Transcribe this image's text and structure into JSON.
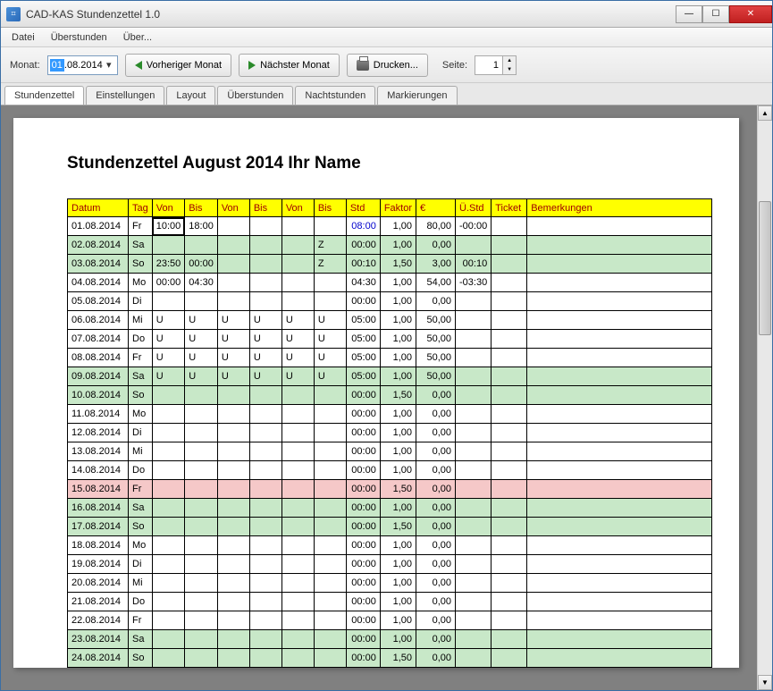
{
  "window": {
    "title": "CAD-KAS Stundenzettel 1.0"
  },
  "menu": {
    "file": "Datei",
    "overtime": "Überstunden",
    "about": "Über..."
  },
  "toolbar": {
    "month_label": "Monat:",
    "date_value": "01.08.2014",
    "date_sel": "01",
    "date_rest": ".08.2014",
    "prev": "Vorheriger Monat",
    "next": "Nächster Monat",
    "print": "Drucken...",
    "page_label": "Seite:",
    "page_value": "1"
  },
  "tabs": [
    "Stundenzettel",
    "Einstellungen",
    "Layout",
    "Überstunden",
    "Nachtstunden",
    "Markierungen"
  ],
  "doc": {
    "title": "Stundenzettel August 2014 Ihr Name"
  },
  "columns": [
    "Datum",
    "Tag",
    "Von",
    "Bis",
    "Von",
    "Bis",
    "Von",
    "Bis",
    "Std",
    "Faktor",
    "€",
    "Ü.Std",
    "Ticket",
    "Bemerkungen"
  ],
  "rows": [
    {
      "date": "01.08.2014",
      "day": "Fr",
      "v1": "10:00",
      "b1": "18:00",
      "v2": "",
      "b2": "",
      "v3": "",
      "b3": "",
      "std": "08:00",
      "faktor": "1,00",
      "eur": "80,00",
      "ustd": "-00:00",
      "cls": "",
      "stdBlue": true,
      "sel": true
    },
    {
      "date": "02.08.2014",
      "day": "Sa",
      "v1": "",
      "b1": "",
      "v2": "",
      "b2": "",
      "v3": "",
      "b3": "Z",
      "std": "00:00",
      "faktor": "1,00",
      "eur": "0,00",
      "ustd": "",
      "cls": "row-green"
    },
    {
      "date": "03.08.2014",
      "day": "So",
      "v1": "23:50",
      "b1": "00:00",
      "v2": "",
      "b2": "",
      "v3": "",
      "b3": "Z",
      "std": "00:10",
      "faktor": "1,50",
      "eur": "3,00",
      "ustd": "00:10",
      "cls": "row-green"
    },
    {
      "date": "04.08.2014",
      "day": "Mo",
      "v1": "00:00",
      "b1": "04:30",
      "v2": "",
      "b2": "",
      "v3": "",
      "b3": "",
      "std": "04:30",
      "faktor": "1,00",
      "eur": "54,00",
      "ustd": "-03:30",
      "cls": ""
    },
    {
      "date": "05.08.2014",
      "day": "Di",
      "v1": "",
      "b1": "",
      "v2": "",
      "b2": "",
      "v3": "",
      "b3": "",
      "std": "00:00",
      "faktor": "1,00",
      "eur": "0,00",
      "ustd": "",
      "cls": ""
    },
    {
      "date": "06.08.2014",
      "day": "Mi",
      "v1": "U",
      "b1": "U",
      "v2": "U",
      "b2": "U",
      "v3": "U",
      "b3": "U",
      "std": "05:00",
      "faktor": "1,00",
      "eur": "50,00",
      "ustd": "",
      "cls": ""
    },
    {
      "date": "07.08.2014",
      "day": "Do",
      "v1": "U",
      "b1": "U",
      "v2": "U",
      "b2": "U",
      "v3": "U",
      "b3": "U",
      "std": "05:00",
      "faktor": "1,00",
      "eur": "50,00",
      "ustd": "",
      "cls": ""
    },
    {
      "date": "08.08.2014",
      "day": "Fr",
      "v1": "U",
      "b1": "U",
      "v2": "U",
      "b2": "U",
      "v3": "U",
      "b3": "U",
      "std": "05:00",
      "faktor": "1,00",
      "eur": "50,00",
      "ustd": "",
      "cls": ""
    },
    {
      "date": "09.08.2014",
      "day": "Sa",
      "v1": "U",
      "b1": "U",
      "v2": "U",
      "b2": "U",
      "v3": "U",
      "b3": "U",
      "std": "05:00",
      "faktor": "1,00",
      "eur": "50,00",
      "ustd": "",
      "cls": "row-green"
    },
    {
      "date": "10.08.2014",
      "day": "So",
      "v1": "",
      "b1": "",
      "v2": "",
      "b2": "",
      "v3": "",
      "b3": "",
      "std": "00:00",
      "faktor": "1,50",
      "eur": "0,00",
      "ustd": "",
      "cls": "row-green"
    },
    {
      "date": "11.08.2014",
      "day": "Mo",
      "v1": "",
      "b1": "",
      "v2": "",
      "b2": "",
      "v3": "",
      "b3": "",
      "std": "00:00",
      "faktor": "1,00",
      "eur": "0,00",
      "ustd": "",
      "cls": ""
    },
    {
      "date": "12.08.2014",
      "day": "Di",
      "v1": "",
      "b1": "",
      "v2": "",
      "b2": "",
      "v3": "",
      "b3": "",
      "std": "00:00",
      "faktor": "1,00",
      "eur": "0,00",
      "ustd": "",
      "cls": ""
    },
    {
      "date": "13.08.2014",
      "day": "Mi",
      "v1": "",
      "b1": "",
      "v2": "",
      "b2": "",
      "v3": "",
      "b3": "",
      "std": "00:00",
      "faktor": "1,00",
      "eur": "0,00",
      "ustd": "",
      "cls": ""
    },
    {
      "date": "14.08.2014",
      "day": "Do",
      "v1": "",
      "b1": "",
      "v2": "",
      "b2": "",
      "v3": "",
      "b3": "",
      "std": "00:00",
      "faktor": "1,00",
      "eur": "0,00",
      "ustd": "",
      "cls": ""
    },
    {
      "date": "15.08.2014",
      "day": "Fr",
      "v1": "",
      "b1": "",
      "v2": "",
      "b2": "",
      "v3": "",
      "b3": "",
      "std": "00:00",
      "faktor": "1,50",
      "eur": "0,00",
      "ustd": "",
      "cls": "row-pink"
    },
    {
      "date": "16.08.2014",
      "day": "Sa",
      "v1": "",
      "b1": "",
      "v2": "",
      "b2": "",
      "v3": "",
      "b3": "",
      "std": "00:00",
      "faktor": "1,00",
      "eur": "0,00",
      "ustd": "",
      "cls": "row-green"
    },
    {
      "date": "17.08.2014",
      "day": "So",
      "v1": "",
      "b1": "",
      "v2": "",
      "b2": "",
      "v3": "",
      "b3": "",
      "std": "00:00",
      "faktor": "1,50",
      "eur": "0,00",
      "ustd": "",
      "cls": "row-green"
    },
    {
      "date": "18.08.2014",
      "day": "Mo",
      "v1": "",
      "b1": "",
      "v2": "",
      "b2": "",
      "v3": "",
      "b3": "",
      "std": "00:00",
      "faktor": "1,00",
      "eur": "0,00",
      "ustd": "",
      "cls": ""
    },
    {
      "date": "19.08.2014",
      "day": "Di",
      "v1": "",
      "b1": "",
      "v2": "",
      "b2": "",
      "v3": "",
      "b3": "",
      "std": "00:00",
      "faktor": "1,00",
      "eur": "0,00",
      "ustd": "",
      "cls": ""
    },
    {
      "date": "20.08.2014",
      "day": "Mi",
      "v1": "",
      "b1": "",
      "v2": "",
      "b2": "",
      "v3": "",
      "b3": "",
      "std": "00:00",
      "faktor": "1,00",
      "eur": "0,00",
      "ustd": "",
      "cls": ""
    },
    {
      "date": "21.08.2014",
      "day": "Do",
      "v1": "",
      "b1": "",
      "v2": "",
      "b2": "",
      "v3": "",
      "b3": "",
      "std": "00:00",
      "faktor": "1,00",
      "eur": "0,00",
      "ustd": "",
      "cls": ""
    },
    {
      "date": "22.08.2014",
      "day": "Fr",
      "v1": "",
      "b1": "",
      "v2": "",
      "b2": "",
      "v3": "",
      "b3": "",
      "std": "00:00",
      "faktor": "1,00",
      "eur": "0,00",
      "ustd": "",
      "cls": ""
    },
    {
      "date": "23.08.2014",
      "day": "Sa",
      "v1": "",
      "b1": "",
      "v2": "",
      "b2": "",
      "v3": "",
      "b3": "",
      "std": "00:00",
      "faktor": "1,00",
      "eur": "0,00",
      "ustd": "",
      "cls": "row-green"
    },
    {
      "date": "24.08.2014",
      "day": "So",
      "v1": "",
      "b1": "",
      "v2": "",
      "b2": "",
      "v3": "",
      "b3": "",
      "std": "00:00",
      "faktor": "1,50",
      "eur": "0,00",
      "ustd": "",
      "cls": "row-green"
    }
  ]
}
